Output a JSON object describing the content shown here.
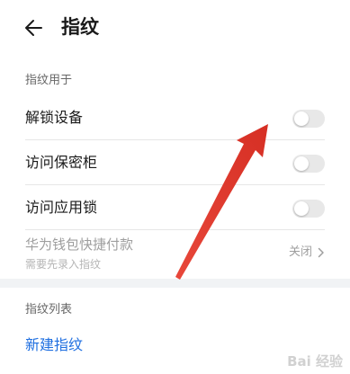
{
  "header": {
    "title": "指纹",
    "back_icon": "back-arrow-icon"
  },
  "usage_section": {
    "label": "指纹用于",
    "items": [
      {
        "label": "解锁设备",
        "enabled": false
      },
      {
        "label": "访问保密柜",
        "enabled": false
      },
      {
        "label": "访问应用锁",
        "enabled": false
      }
    ],
    "payment": {
      "title": "华为钱包快捷付款",
      "subtitle": "需要先录入指纹",
      "status": "关闭"
    }
  },
  "list_section": {
    "label": "指纹列表",
    "new_label": "新建指纹"
  },
  "colors": {
    "accent": "#1f6fe0",
    "annotation_arrow": "#e8473a"
  },
  "watermark": "Bai 经验"
}
